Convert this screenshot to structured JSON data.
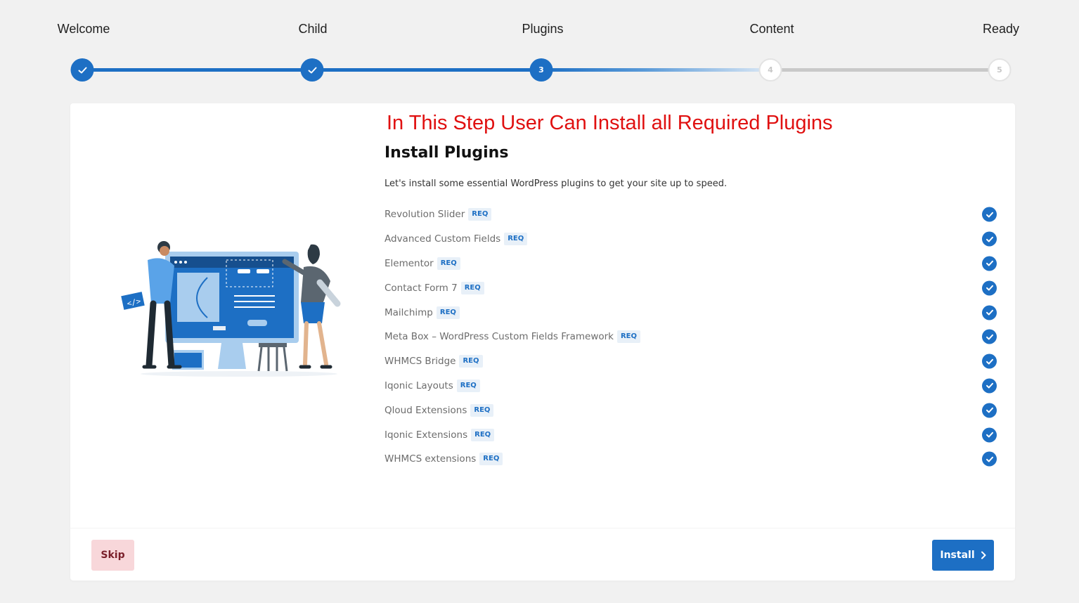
{
  "steps": [
    {
      "label": "Welcome",
      "number": "1",
      "state": "done"
    },
    {
      "label": "Child",
      "number": "2",
      "state": "done"
    },
    {
      "label": "Plugins",
      "number": "3",
      "state": "active"
    },
    {
      "label": "Content",
      "number": "4",
      "state": "todo"
    },
    {
      "label": "Ready",
      "number": "5",
      "state": "todo"
    }
  ],
  "annotation": "In This Step User Can Install all Required Plugins",
  "title": "Install Plugins",
  "description": "Let's install some essential WordPress plugins to get your site up to speed.",
  "badge_label": "REQ",
  "plugins": [
    "Revolution Slider",
    "Advanced Custom Fields",
    "Elementor",
    "Contact Form 7",
    "Mailchimp",
    "Meta Box – WordPress Custom Fields Framework",
    "WHMCS Bridge",
    "Iqonic Layouts",
    "Qloud Extensions",
    "Iqonic Extensions",
    "WHMCS extensions"
  ],
  "buttons": {
    "skip": "Skip",
    "install": "Install"
  },
  "colors": {
    "primary": "#1d6fc4",
    "annotation": "#e01010",
    "skip_bg": "#f8d7da",
    "skip_text": "#7a1f2a"
  },
  "icons": {
    "step_done": "check-icon",
    "plugin_status": "check-circle-icon",
    "install": "chevron-right-icon"
  }
}
